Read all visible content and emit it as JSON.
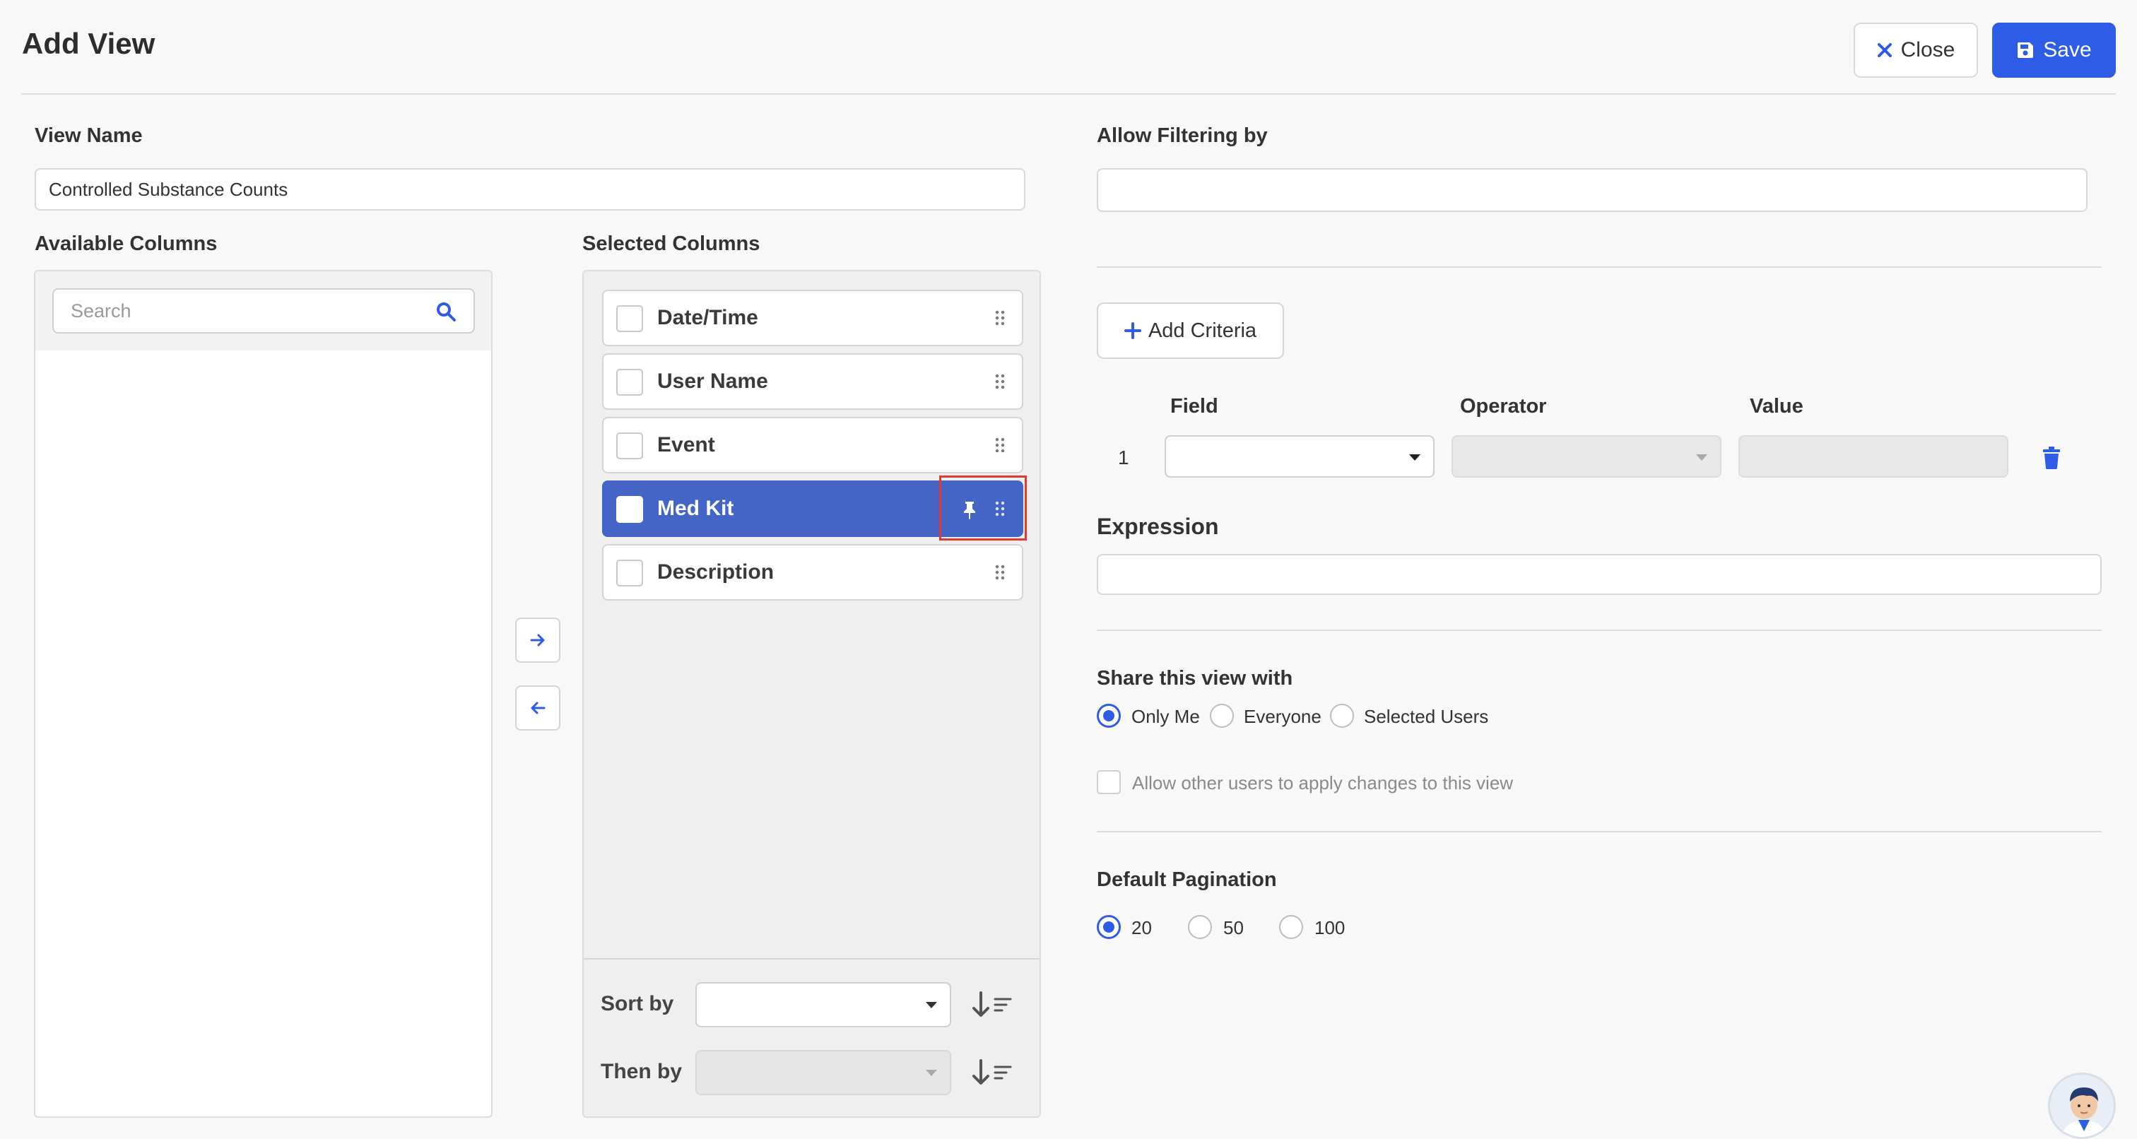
{
  "header": {
    "title": "Add View",
    "close_label": "Close",
    "save_label": "Save"
  },
  "view_name": {
    "label": "View Name",
    "value": "Controlled Substance Counts"
  },
  "available_columns": {
    "label": "Available Columns",
    "search_placeholder": "Search"
  },
  "selected_columns": {
    "label": "Selected Columns",
    "items": [
      {
        "label": "Date/Time"
      },
      {
        "label": "User Name"
      },
      {
        "label": "Event"
      },
      {
        "label": "Med Kit"
      },
      {
        "label": "Description"
      }
    ]
  },
  "sort": {
    "sort_by_label": "Sort by",
    "then_by_label": "Then by"
  },
  "filtering": {
    "label": "Allow Filtering by",
    "value": ""
  },
  "criteria": {
    "add_label": "Add Criteria",
    "field_header": "Field",
    "operator_header": "Operator",
    "value_header": "Value",
    "row_number": "1"
  },
  "expression": {
    "label": "Expression",
    "value": ""
  },
  "share": {
    "label": "Share this view with",
    "options": [
      "Only Me",
      "Everyone",
      "Selected Users"
    ],
    "selected": "Only Me",
    "allow_changes_label": "Allow other users to apply changes to this view"
  },
  "pagination": {
    "label": "Default Pagination",
    "options": [
      "20",
      "50",
      "100"
    ],
    "selected": "20"
  },
  "colors": {
    "primary": "#2f5ce6",
    "highlight_row": "#4465c6",
    "annotation": "#e03b2e"
  },
  "icons": [
    "close-icon",
    "save-icon",
    "search-icon",
    "arrow-right-icon",
    "arrow-left-icon",
    "drag-handle-icon",
    "pin-icon",
    "plus-icon",
    "chevron-down-icon",
    "sort-icon",
    "trash-icon",
    "avatar"
  ]
}
